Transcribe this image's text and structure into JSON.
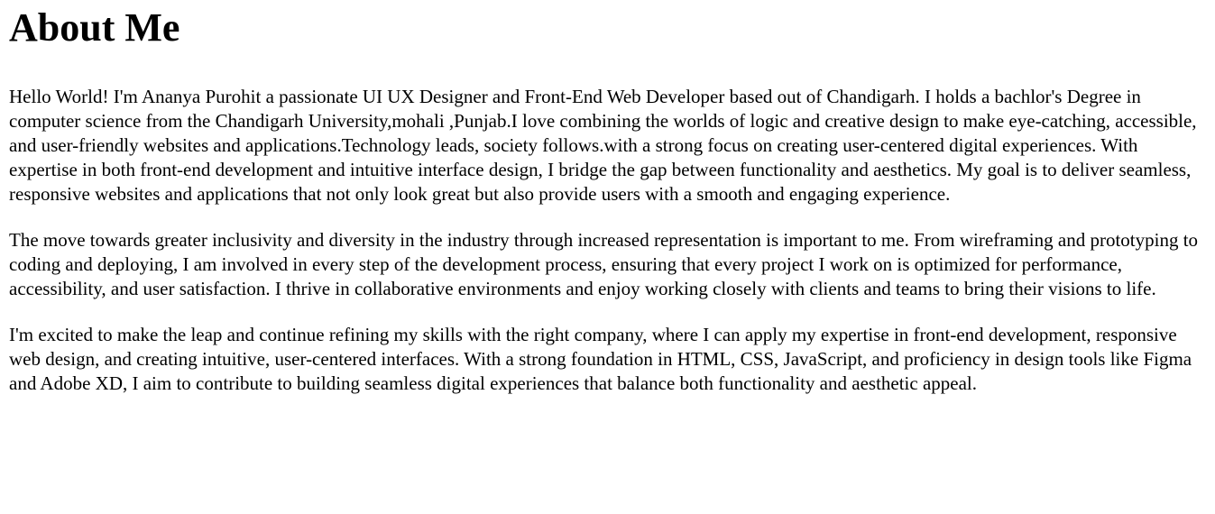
{
  "heading": "About Me",
  "paragraphs": [
    "Hello World! I'm Ananya Purohit a passionate UI UX Designer and Front-End Web Developer based out of Chandigarh. I holds a bachlor's Degree in computer science from the Chandigarh University,mohali ,Punjab.I love combining the worlds of logic and creative design to make eye-catching, accessible, and user-friendly websites and applications.Technology leads, society follows.with a strong focus on creating user-centered digital experiences. With expertise in both front-end development and intuitive interface design, I bridge the gap between functionality and aesthetics. My goal is to deliver seamless, responsive websites and applications that not only look great but also provide users with a smooth and engaging experience.",
    "The move towards greater inclusivity and diversity in the industry through increased representation is important to me. From wireframing and prototyping to coding and deploying, I am involved in every step of the development process, ensuring that every project I work on is optimized for performance, accessibility, and user satisfaction. I thrive in collaborative environments and enjoy working closely with clients and teams to bring their visions to life.",
    "I'm excited to make the leap and continue refining my skills with the right company, where I can apply my expertise in front-end development, responsive web design, and creating intuitive, user-centered interfaces. With a strong foundation in HTML, CSS, JavaScript, and proficiency in design tools like Figma and Adobe XD, I aim to contribute to building seamless digital experiences that balance both functionality and aesthetic appeal."
  ]
}
